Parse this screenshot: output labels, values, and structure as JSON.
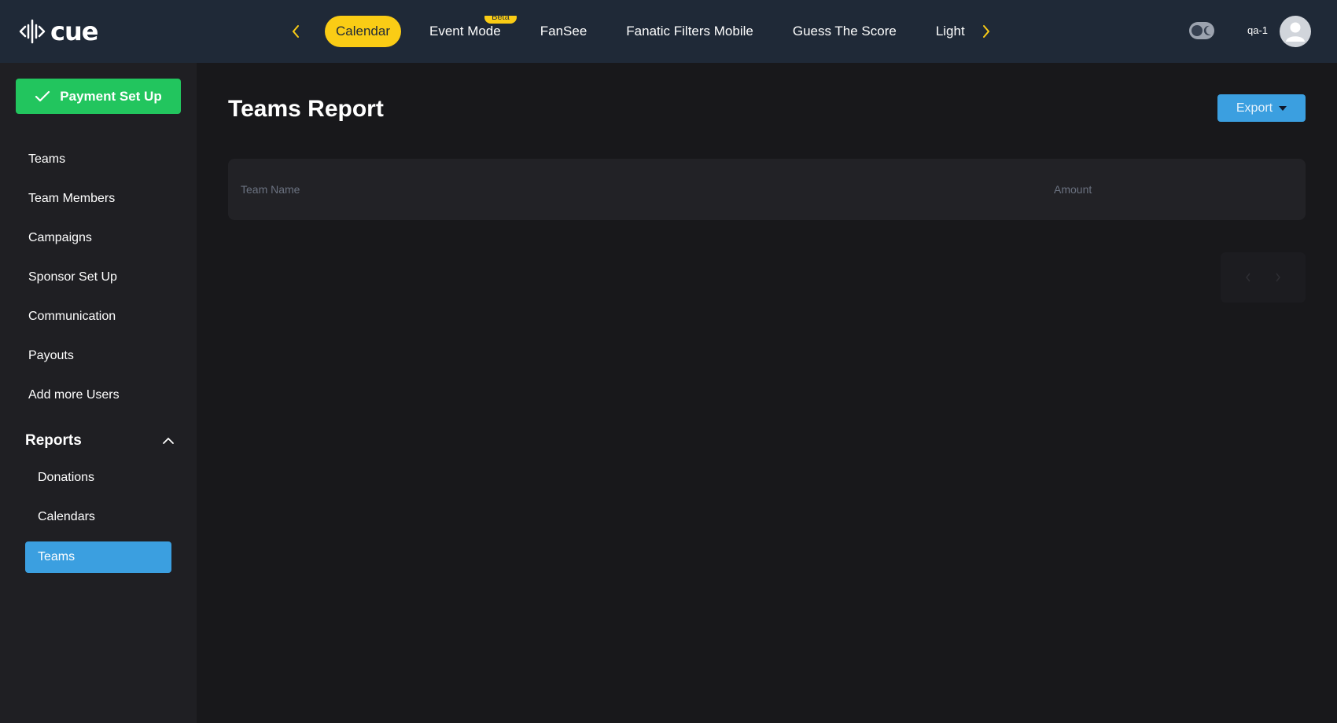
{
  "app": {
    "logo_text": "cue"
  },
  "topnav": {
    "tabs": [
      {
        "label": "Calendar",
        "active": true
      },
      {
        "label": "Event Mode",
        "badge": "Beta"
      },
      {
        "label": "FanSee"
      },
      {
        "label": "Fanatic Filters Mobile"
      },
      {
        "label": "Guess The Score"
      },
      {
        "label": "Light"
      }
    ],
    "username": "qa-1",
    "accent_color": "#facc15"
  },
  "sidebar": {
    "payment_button": "Payment Set Up",
    "items": [
      {
        "label": "Teams"
      },
      {
        "label": "Team Members"
      },
      {
        "label": "Campaigns"
      },
      {
        "label": "Sponsor Set Up"
      },
      {
        "label": "Communication"
      },
      {
        "label": "Payouts"
      },
      {
        "label": "Add more Users"
      }
    ],
    "reports": {
      "label": "Reports",
      "items": [
        {
          "label": "Donations"
        },
        {
          "label": "Calendars"
        },
        {
          "label": "Teams",
          "active": true
        }
      ]
    }
  },
  "main": {
    "title": "Teams Report",
    "export_label": "Export",
    "table": {
      "columns": [
        "Team Name",
        "Amount"
      ],
      "rows": []
    }
  }
}
